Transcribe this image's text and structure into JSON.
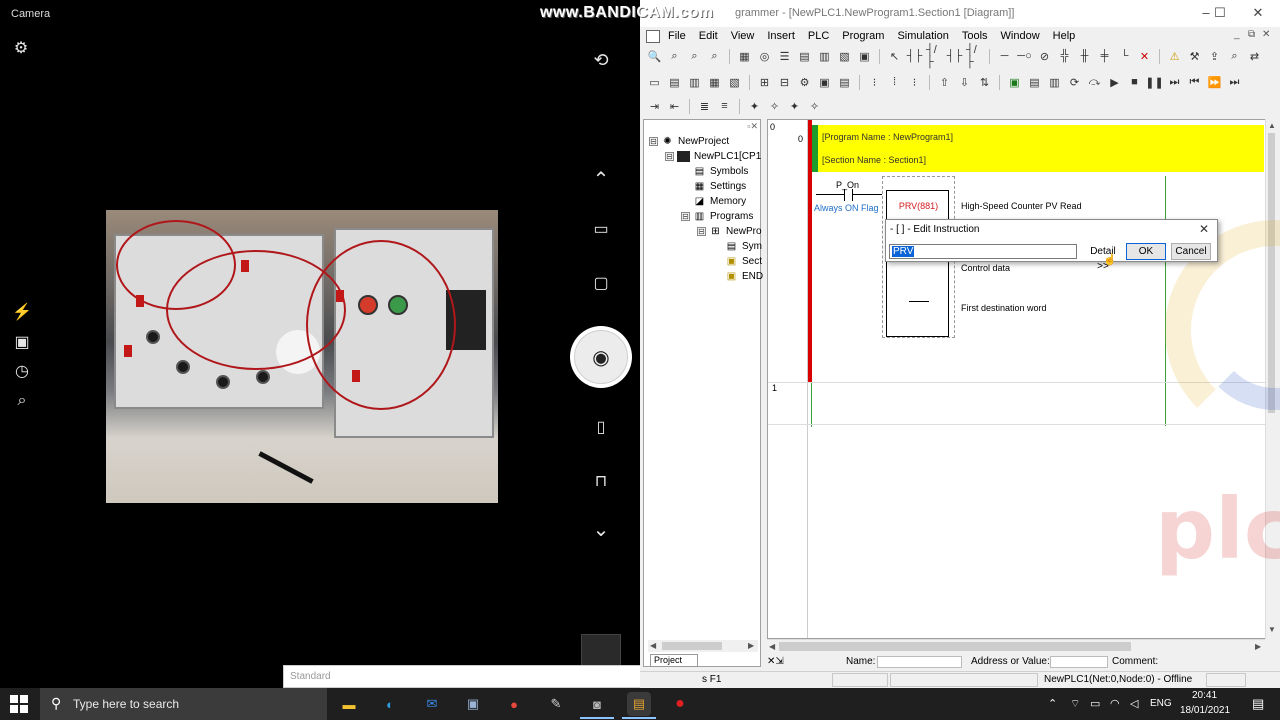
{
  "camera": {
    "title": "Camera",
    "left_icons": [
      {
        "name": "flash-icon",
        "glyph": "⚡"
      },
      {
        "name": "hdr-icon",
        "glyph": "▣"
      },
      {
        "name": "timer-icon",
        "glyph": "◷"
      },
      {
        "name": "zoom-icon",
        "glyph": "⌕"
      }
    ],
    "right_icons": [
      {
        "name": "switch-camera-icon",
        "glyph": "⟲"
      },
      {
        "name": "chevron-up-icon",
        "glyph": "⌃"
      },
      {
        "name": "photo-mode-icon",
        "glyph": "▭"
      },
      {
        "name": "video-mode-icon",
        "glyph": "▢"
      },
      {
        "name": "document-mode-icon",
        "glyph": "▯"
      },
      {
        "name": "whiteboard-mode-icon",
        "glyph": "⊓"
      },
      {
        "name": "chevron-down-icon",
        "glyph": "⌄"
      }
    ],
    "shutter_glyph": "◉",
    "standard_label": "Standard"
  },
  "recorder": {
    "watermark": "www.BANDICAM.com"
  },
  "cxp": {
    "window_title": "grammer - [NewPLC1.NewProgram1.Section1 [Diagram]]",
    "menu": [
      "File",
      "Edit",
      "View",
      "Insert",
      "PLC",
      "Program",
      "Simulation",
      "Tools",
      "Window",
      "Help"
    ],
    "tree": {
      "items": [
        {
          "label": "NewProject",
          "exp": "⊟"
        },
        {
          "label": "NewPLC1[CP1",
          "exp": "⊟"
        },
        {
          "label": "Symbols",
          "exp": ""
        },
        {
          "label": "Settings",
          "exp": ""
        },
        {
          "label": "Memory",
          "exp": ""
        },
        {
          "label": "Programs",
          "exp": "⊟"
        },
        {
          "label": "NewPro",
          "exp": "⊟"
        },
        {
          "label": "Sym",
          "exp": ""
        },
        {
          "label": "Sect",
          "exp": ""
        },
        {
          "label": "END",
          "exp": ""
        }
      ],
      "tab": "Project"
    },
    "ladder": {
      "rung0": "0",
      "rung1": "1",
      "program_name": "[Program Name : NewProgram1]",
      "section_name": "[Section Name : Section1]",
      "contact_name": "P_On",
      "contact_comment": "Always ON Flag",
      "instruction": "PRV(881)",
      "operand_comments": [
        "High-Speed Counter PV Read",
        "Control data",
        "First destination word"
      ]
    },
    "watch": {
      "name_label": "Name:",
      "address_label": "Address or Value:",
      "comment_label": "Comment:"
    },
    "status": {
      "help_text": "s F1",
      "plc_status": "NewPLC1(Net:0,Node:0) - Offline"
    },
    "dialog": {
      "title": "- [ ] - Edit Instruction",
      "input_value": "PRV",
      "detail_button": "Detail >>",
      "ok_button": "OK",
      "cancel_button": "Cancel"
    }
  },
  "taskbar": {
    "search_placeholder": "Type here to search",
    "apps": [
      {
        "name": "file-explorer-icon",
        "glyph": "▬",
        "color": "#f2c230"
      },
      {
        "name": "edge-icon",
        "glyph": "◐",
        "color": "#2ea0e0"
      },
      {
        "name": "mail-icon",
        "glyph": "✉",
        "color": "#3c8ae8"
      },
      {
        "name": "store-icon",
        "glyph": "▣",
        "color": "#9ab4d8"
      },
      {
        "name": "chrome-icon",
        "glyph": "●",
        "color": "#e5483a"
      },
      {
        "name": "app-icon",
        "glyph": "✎",
        "color": "#cfcfcf"
      },
      {
        "name": "camera-app-icon",
        "glyph": "◙",
        "color": "#b8b8b8"
      },
      {
        "name": "cx-programmer-icon",
        "glyph": "▤",
        "color": "#e0a030"
      },
      {
        "name": "bandicam-icon",
        "glyph": "●",
        "color": "#e02020"
      }
    ],
    "language": "ENG",
    "time": "20:41",
    "date": "18/01/2021"
  }
}
